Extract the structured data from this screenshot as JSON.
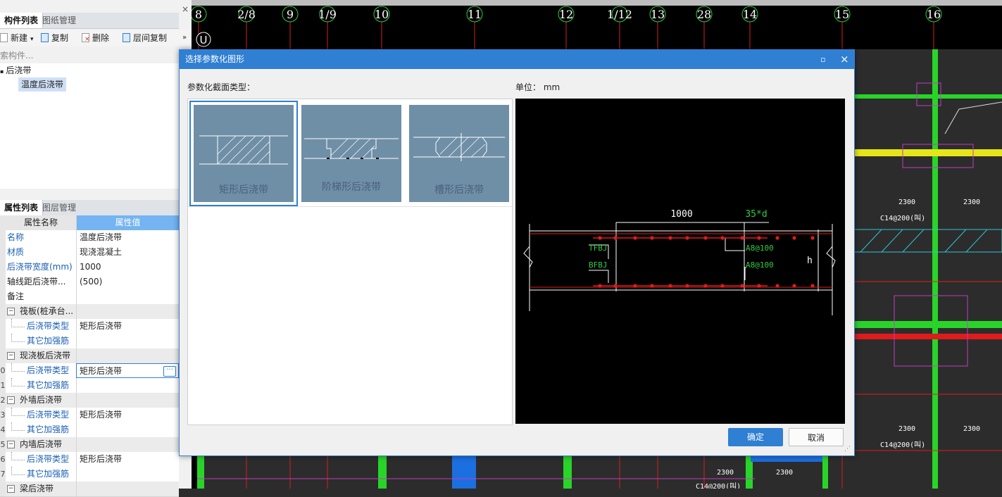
{
  "top_panel": {
    "tabs": [
      "构件列表",
      "图纸管理"
    ],
    "toolbar": {
      "new": "新建",
      "copy": "复制",
      "delete": "删除",
      "floor_copy": "层间复制",
      "more": "»"
    },
    "search_placeholder": "索构件...",
    "tree": {
      "root": "后浇带",
      "child": "温度后浇带"
    }
  },
  "bottom_panel": {
    "tabs": [
      "属性列表",
      "图层管理"
    ],
    "headers": {
      "name": "属性名称",
      "value": "属性值"
    },
    "rows": [
      {
        "num": "",
        "name": "名称",
        "value": "温度后浇带",
        "style": "blue",
        "indent": 0
      },
      {
        "num": "",
        "name": "材质",
        "value": "现浇混凝土",
        "style": "blue",
        "indent": 0
      },
      {
        "num": "",
        "name": "后浇带宽度(mm)",
        "value": "1000",
        "style": "blue",
        "indent": 0
      },
      {
        "num": "",
        "name": "轴线距后浇带...",
        "value": "(500)",
        "style": "plain",
        "indent": 0
      },
      {
        "num": "",
        "name": "备注",
        "value": "",
        "style": "plain",
        "indent": 0
      },
      {
        "num": "",
        "name": "筏板(桩承台...",
        "value": "",
        "style": "group",
        "indent": 0
      },
      {
        "num": "",
        "name": "后浇带类型",
        "value": "矩形后浇带",
        "style": "blue",
        "indent": 1
      },
      {
        "num": "",
        "name": "其它加强筋",
        "value": "",
        "style": "blue",
        "indent": 1
      },
      {
        "num": "",
        "name": "现浇板后浇带",
        "value": "",
        "style": "group",
        "indent": 0
      },
      {
        "num": "0",
        "name": "后浇带类型",
        "value": "矩形后浇带",
        "style": "blue",
        "indent": 1,
        "editing": true
      },
      {
        "num": "1",
        "name": "其它加强筋",
        "value": "",
        "style": "blue",
        "indent": 1
      },
      {
        "num": "2",
        "name": "外墙后浇带",
        "value": "",
        "style": "group",
        "indent": 0
      },
      {
        "num": "3",
        "name": "后浇带类型",
        "value": "矩形后浇带",
        "style": "blue",
        "indent": 1
      },
      {
        "num": "4",
        "name": "其它加强筋",
        "value": "",
        "style": "blue",
        "indent": 1
      },
      {
        "num": "5",
        "name": "内墙后浇带",
        "value": "",
        "style": "group",
        "indent": 0
      },
      {
        "num": "6",
        "name": "后浇带类型",
        "value": "矩形后浇带",
        "style": "blue",
        "indent": 1
      },
      {
        "num": "7",
        "name": "其它加强筋",
        "value": "",
        "style": "blue",
        "indent": 1
      },
      {
        "num": "",
        "name": "梁后浇带",
        "value": "",
        "style": "group",
        "indent": 0
      }
    ],
    "ellipsis": "···"
  },
  "cad": {
    "axes": [
      "8",
      "2/8",
      "9",
      "1/9",
      "10",
      "11",
      "12",
      "1/12",
      "13",
      "28",
      "14",
      "15",
      "16"
    ],
    "row_axis": "U",
    "dims": [
      "2300",
      "2300",
      "C14@200(叫)",
      "2300",
      "2300",
      "C14@200(叫)",
      "2300",
      "2300",
      "C14@200(叫)"
    ]
  },
  "dialog": {
    "title": "选择参数化图形",
    "section_label": "参数化截面类型：",
    "unit_label": "单位：  mm",
    "options": [
      "矩形后浇带",
      "阶梯形后浇带",
      "槽形后浇带"
    ],
    "selected": 0,
    "preview": {
      "width": "1000",
      "lap": "35*d",
      "top": "TFBJ",
      "bottom": "BFBJ",
      "rebar_top": "A8@100",
      "rebar_bottom": "A8@100",
      "height": "h"
    },
    "ok": "确定",
    "cancel": "取消"
  },
  "colors": {
    "accent": "#2f7fd3",
    "cad_bg": "#000000",
    "green_axis": "#2ecc40"
  }
}
